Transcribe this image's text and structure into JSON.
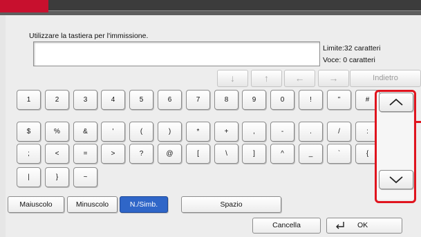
{
  "input": {
    "prompt": "Utilizzare la tastiera per l'immissione.",
    "value": ""
  },
  "info": {
    "limit": "Limite:32 caratteri",
    "entry": "Voce:   0 caratteri"
  },
  "nav": {
    "down_icon": "down-arrow-icon",
    "up_icon": "up-arrow-icon",
    "left_icon": "left-arrow-icon",
    "right_icon": "right-arrow-icon",
    "down": "↓",
    "up": "↑",
    "left": "←",
    "right": "→",
    "back": "Indietro"
  },
  "keyboard": {
    "rows": [
      [
        "1",
        "2",
        "3",
        "4",
        "5",
        "6",
        "7",
        "8",
        "9",
        "0",
        "!",
        "\"",
        "#"
      ],
      [
        "$",
        "%",
        "&",
        "'",
        "(",
        ")",
        "*",
        "+",
        ",",
        "-",
        ".",
        "/",
        ":"
      ],
      [
        ";",
        "<",
        "=",
        ">",
        "?",
        "@",
        "[",
        "\\",
        "]",
        "^",
        "_",
        "`",
        "{"
      ],
      [
        "|",
        "}",
        "~"
      ]
    ]
  },
  "scroll": {
    "up_icon": "chevron-up-icon",
    "down_icon": "chevron-down-icon"
  },
  "modes": {
    "upper": "Maiuscolo",
    "lower": "Minuscolo",
    "symbols": "N./Simb.",
    "selected": "N./Simb."
  },
  "space": "Spazio",
  "footer": {
    "cancel": "Cancella",
    "ok": "OK",
    "ok_icon": "enter-arrow-icon"
  },
  "colors": {
    "highlight": "#e0141e",
    "selected_mode": "#2f66c8",
    "top_accent": "#c8102e"
  }
}
